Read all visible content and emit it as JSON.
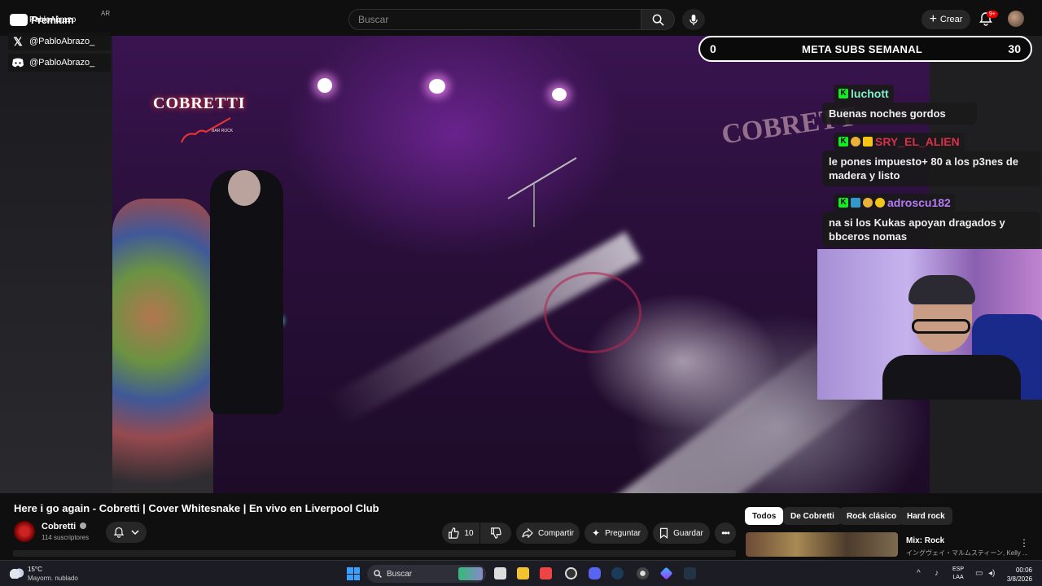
{
  "topbar": {
    "logo_text": "Premium",
    "logo_overlay_text": "PabloAbrazo",
    "region": "AR",
    "search_placeholder": "Buscar",
    "create_label": "Crear",
    "notification_count": "9+"
  },
  "socials": [
    {
      "icon": "youtube-icon",
      "handle": "PabloAbrazo"
    },
    {
      "icon": "x-icon",
      "handle": "@PabloAbrazo_"
    },
    {
      "icon": "discord-icon",
      "handle": "@PabloAbrazo_"
    }
  ],
  "video_scene": {
    "sign_left": "COBRETTI",
    "sign_left_sub": "BAR ROCK",
    "sign_right": "COBRETT"
  },
  "meta_subs": {
    "current": "0",
    "label": "META SUBS SEMANAL",
    "goal": "30"
  },
  "chat": [
    {
      "user": "luchott",
      "color": "#7ff0c4",
      "message": "Buenas noches gordos"
    },
    {
      "user": "SRY_EL_ALIEN",
      "color": "#d9304a",
      "message": "le pones impuesto+ 80 a los p3nes de madera y listo"
    },
    {
      "user": "adroscu182",
      "color": "#b77cf5",
      "message": "na si los Kukas apoyan dragados y bbceros nomas"
    }
  ],
  "video_info": {
    "title": "Here i go again - Cobretti | Cover Whitesnake | En vivo en Liverpool Club",
    "channel": "Cobretti",
    "subscribers": "114 suscriptores",
    "likes": "10",
    "share_label": "Compartir",
    "ask_label": "Preguntar",
    "save_label": "Guardar"
  },
  "chips": [
    "Todos",
    "De Cobretti",
    "Rock clásico",
    "Hard rock"
  ],
  "recommendation": {
    "title": "Mix: Rock",
    "subtitle": "イングヴェイ・マルムスティーン, Kelly ..."
  },
  "taskbar": {
    "temperature": "15°C",
    "weather": "Mayorm. nublado",
    "search_label": "Buscar",
    "lang_top": "ESP",
    "lang_bottom": "LAA",
    "time": "00:06",
    "date": "3/8/2026"
  }
}
